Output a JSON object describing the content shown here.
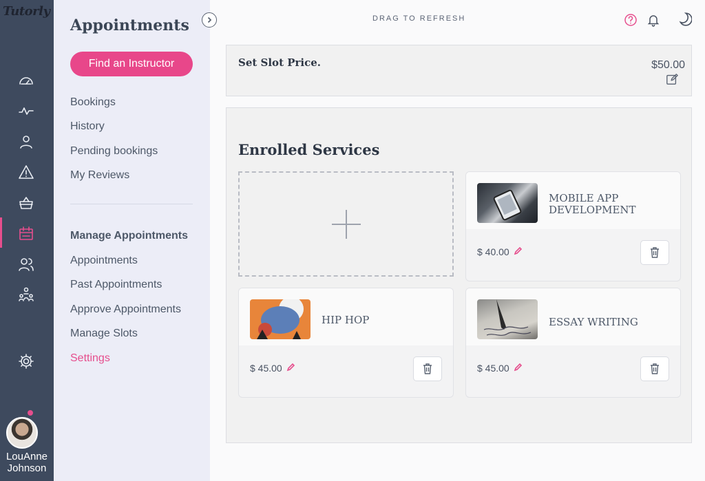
{
  "app": {
    "logo_text": "Tutorly"
  },
  "user": {
    "name": "LouAnne Johnson"
  },
  "rail": {
    "icons": [
      "dashboard-icon",
      "activity-icon",
      "profile-icon",
      "alert-icon",
      "basket-icon",
      "calendar-icon",
      "users-icon",
      "community-icon",
      "settings-gear-icon"
    ],
    "active": "calendar-icon",
    "accent_color": "#e64e8d"
  },
  "sidebar": {
    "title": "Appointments",
    "find_button": "Find an Instructor",
    "links": [
      "Bookings",
      "History",
      "Pending bookings",
      "My Reviews"
    ],
    "manage_heading": "Manage Appointments",
    "manage_links": [
      "Appointments",
      "Past Appointments",
      "Approve Appointments",
      "Manage Slots",
      "Settings"
    ],
    "active_link": "Settings"
  },
  "topbar": {
    "drag_text": "DRAG TO REFRESH",
    "icons": [
      "help-icon",
      "bell-icon",
      "moon-icon"
    ]
  },
  "slot": {
    "label": "Set Slot Price.",
    "price": "$50.00"
  },
  "enrolled": {
    "title": "Enrolled Services",
    "services": [
      {
        "title_line1": "MOBILE APP",
        "title_line2": "DEVELOPMENT",
        "price": "$ 40.00"
      },
      {
        "title_line1": "HIP HOP",
        "title_line2": "",
        "price": "$ 45.00"
      },
      {
        "title_line1": "ESSAY WRITING",
        "title_line2": "",
        "price": "$ 45.00"
      }
    ]
  }
}
